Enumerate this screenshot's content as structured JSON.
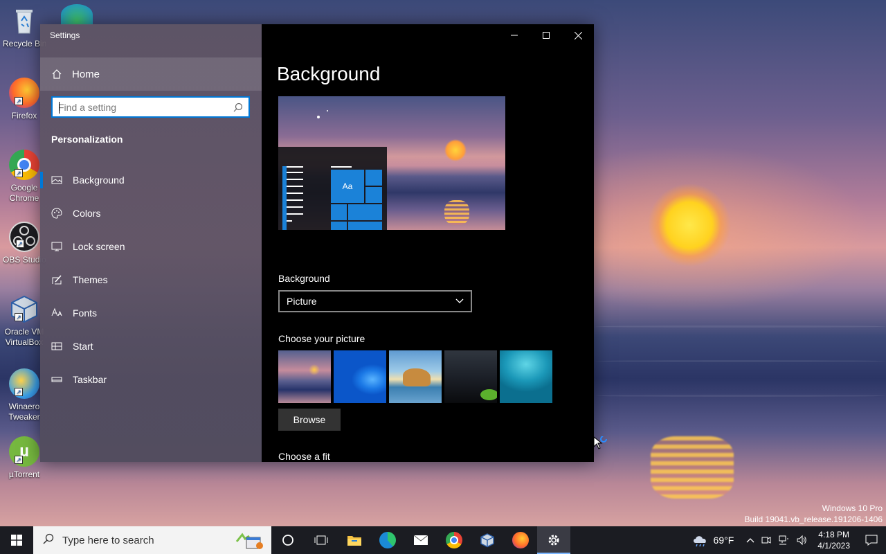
{
  "desktop": {
    "icons": [
      {
        "label": "Recycle Bin",
        "icon": "recycle-bin-icon"
      },
      {
        "label": "Firefox",
        "icon": "firefox-icon"
      },
      {
        "label": "Google Chrome",
        "icon": "chrome-icon"
      },
      {
        "label": "OBS Studio",
        "icon": "obs-icon"
      },
      {
        "label": "Oracle VM VirtualBox",
        "icon": "virtualbox-icon"
      },
      {
        "label": "Winaero Tweaker",
        "icon": "winaero-icon"
      },
      {
        "label": "µTorrent",
        "icon": "utorrent-icon"
      }
    ],
    "watermark": {
      "line1": "Windows 10 Pro",
      "line2": "Build 19041.vb_release.191206-1406"
    }
  },
  "settings": {
    "window_title": "Settings",
    "home_label": "Home",
    "search_placeholder": "Find a setting",
    "section_title": "Personalization",
    "nav": [
      {
        "label": "Background",
        "icon": "picture-icon",
        "active": true
      },
      {
        "label": "Colors",
        "icon": "palette-icon",
        "active": false
      },
      {
        "label": "Lock screen",
        "icon": "lock-screen-icon",
        "active": false
      },
      {
        "label": "Themes",
        "icon": "themes-icon",
        "active": false
      },
      {
        "label": "Fonts",
        "icon": "fonts-icon",
        "active": false
      },
      {
        "label": "Start",
        "icon": "start-icon",
        "active": false
      },
      {
        "label": "Taskbar",
        "icon": "taskbar-icon",
        "active": false
      }
    ],
    "content": {
      "title": "Background",
      "preview_tile_text": "Aa",
      "background_label": "Background",
      "background_value": "Picture",
      "choose_picture_label": "Choose your picture",
      "browse_label": "Browse",
      "choose_fit_label": "Choose a fit"
    }
  },
  "taskbar": {
    "search_placeholder": "Type here to search",
    "apps": [
      "cortana-icon",
      "task-view-icon",
      "file-explorer-icon",
      "edge-icon",
      "mail-icon",
      "chrome-icon",
      "virtualbox-icon",
      "firefox-icon",
      "settings-gear-icon"
    ],
    "weather_temp": "69°F",
    "time": "4:18 PM",
    "date": "4/1/2023"
  },
  "colors": {
    "accent": "#0078d7",
    "window_content_bg": "#000000",
    "taskbar_bg": "#1b1c22"
  }
}
